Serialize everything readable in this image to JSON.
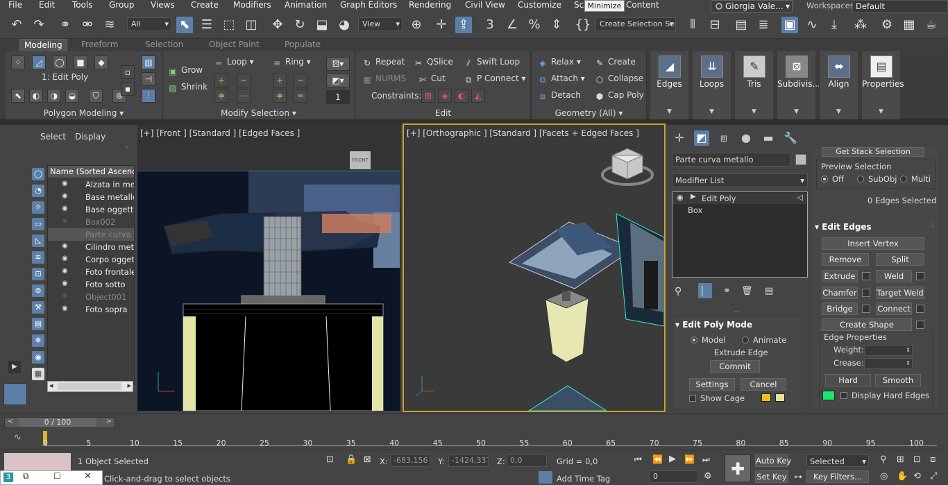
{
  "menu": [
    "File",
    "Edit",
    "Tools",
    "Group",
    "Views",
    "Create",
    "Modifiers",
    "Animation",
    "Graph Editors",
    "Rendering",
    "Civil View",
    "Customize",
    "Sc",
    "Content"
  ],
  "tooltip": "Minimize",
  "user": "Giorgia Vale...",
  "workspaces_label": "Workspaces:",
  "workspaces_value": "Default",
  "toolbar": {
    "filter": "All",
    "refcoord": "View",
    "named_sel": "Create Selection Se"
  },
  "ribbon_tabs": [
    "Modeling",
    "Freeform",
    "Selection",
    "Object Paint",
    "Populate"
  ],
  "ribbon": {
    "polygon_modeling": {
      "title": "Polygon Modeling",
      "level": "1: Edit Poly"
    },
    "modify_selection": {
      "title": "Modify Selection",
      "grow": "Grow",
      "shrink": "Shrink",
      "loop": "Loop",
      "ring": "Ring"
    },
    "edit": {
      "title": "Edit",
      "repeat": "Repeat",
      "nurms": "NURMS",
      "constraints": "Constraints:",
      "qslice": "QSlice",
      "cut": "Cut",
      "swift_loop": "Swift Loop",
      "p_connect": "P Connect",
      "spinner": "1"
    },
    "geometry": {
      "title": "Geometry (All)",
      "relax": "Relax",
      "attach": "Attach",
      "detach": "Detach",
      "create": "Create",
      "collapse": "Collapse",
      "cap_poly": "Cap Poly"
    },
    "big": [
      "Edges",
      "Loops",
      "Tris",
      "Subdivis...",
      "Align",
      "Properties"
    ]
  },
  "explorer": {
    "tabs": [
      "Select",
      "Display"
    ],
    "header": "Name (Sorted Ascending)",
    "items": [
      {
        "name": "Alzata in metallo",
        "hidden": false,
        "sel": false
      },
      {
        "name": "Base metallo",
        "hidden": false,
        "sel": false
      },
      {
        "name": "Base oggetto",
        "hidden": false,
        "sel": false
      },
      {
        "name": "Box002",
        "hidden": true,
        "sel": false
      },
      {
        "name": "Parte curva metallo",
        "hidden": true,
        "sel": true
      },
      {
        "name": "Cilindro metallo",
        "hidden": false,
        "sel": false
      },
      {
        "name": "Corpo oggetto",
        "hidden": false,
        "sel": false
      },
      {
        "name": "Foto frontale",
        "hidden": false,
        "sel": false
      },
      {
        "name": "Foto sotto",
        "hidden": false,
        "sel": false
      },
      {
        "name": "Object001",
        "hidden": true,
        "sel": false
      },
      {
        "name": "Foto sopra",
        "hidden": false,
        "sel": false
      }
    ]
  },
  "viewport_front": {
    "label": "[+] [Front ] [Standard ] [Edged Faces ]",
    "cube": "FRONT"
  },
  "viewport_ortho": {
    "label": "[+] [Orthographic ] [Standard ] [Facets + Edged Faces ]"
  },
  "command_panel": {
    "object_name": "Parte curva metallo",
    "modifier_list": "Modifier List",
    "stack": [
      "Edit Poly",
      "Box"
    ],
    "get_stack_selection": "Get Stack Selection",
    "preview_selection": "Preview Selection",
    "preview_opts": [
      "Off",
      "SubObj",
      "Multi"
    ],
    "edges_selected": "0 Edges Selected",
    "edit_edges": "Edit Edges",
    "insert_vertex": "Insert Vertex",
    "remove": "Remove",
    "split": "Split",
    "extrude": "Extrude",
    "weld": "Weld",
    "chamfer": "Chamfer",
    "target_weld": "Target Weld",
    "bridge": "Bridge",
    "connect": "Connect",
    "create_shape": "Create Shape",
    "edge_properties": "Edge Properties",
    "weight": "Weight:",
    "crease": "Crease:",
    "hard": "Hard",
    "smooth": "Smooth",
    "display_hard_edges": "Display Hard Edges",
    "edit_poly_mode": "Edit Poly Mode",
    "model": "Model",
    "animate": "Animate",
    "extrude_edge": "Extrude Edge",
    "commit": "Commit",
    "settings": "Settings",
    "cancel": "Cancel",
    "show_cage": "Show Cage",
    "swatch_colors": [
      "#f2c01c",
      "#e6e29a"
    ],
    "hard_edge_color": "#19e66a"
  },
  "timeline": {
    "frame": "0 / 100",
    "ticks": [
      "0",
      "5",
      "10",
      "15",
      "20",
      "25",
      "30",
      "35",
      "40",
      "45",
      "50",
      "55",
      "60",
      "65",
      "70",
      "75",
      "80",
      "85",
      "90",
      "95",
      "100"
    ]
  },
  "status": {
    "selected": "1 Object Selected",
    "prompt": "Click-and-drag to select objects",
    "x": "-683,156",
    "y": "-1424,337",
    "z": "0,0",
    "grid": "Grid = 0,0",
    "add_time_tag": "Add Time Tag",
    "auto_key": "Auto Key",
    "set_key": "Set Key",
    "key_mode": "Selected",
    "key_filters": "Key Filters...",
    "frame_spin": "0"
  }
}
